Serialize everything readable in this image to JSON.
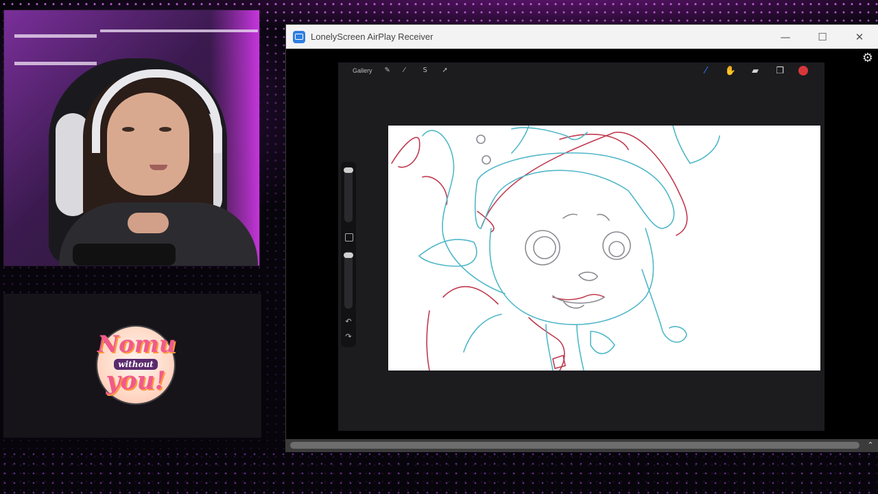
{
  "window": {
    "title": "LonelyScreen AirPlay Receiver",
    "minimize_glyph": "—",
    "maximize_glyph": "☐",
    "close_glyph": "✕",
    "settings_glyph": "⚙",
    "scroll_up_glyph": "⌃"
  },
  "procreate": {
    "gallery_label": "Gallery",
    "left_tools": [
      {
        "icon": "wrench-icon",
        "glyph": "✎"
      },
      {
        "icon": "adjustments-icon",
        "glyph": "⁄"
      },
      {
        "icon": "selection-icon",
        "glyph": "S"
      },
      {
        "icon": "transform-icon",
        "glyph": "➚"
      }
    ],
    "right_tools": [
      {
        "icon": "brush-icon",
        "glyph": "⁄"
      },
      {
        "icon": "smudge-icon",
        "glyph": "✋"
      },
      {
        "icon": "eraser-icon",
        "glyph": "▰"
      },
      {
        "icon": "layers-icon",
        "glyph": "❐"
      }
    ],
    "active_color": "#d7373b",
    "undo_glyph": "↶",
    "redo_glyph": "↷"
  },
  "logo": {
    "line1": "Nomu",
    "line2": "without",
    "line3": "you!"
  },
  "colors": {
    "accent_purple": "#c040e0",
    "sketch_red": "#c0394f",
    "sketch_cyan": "#4fb7c8"
  }
}
